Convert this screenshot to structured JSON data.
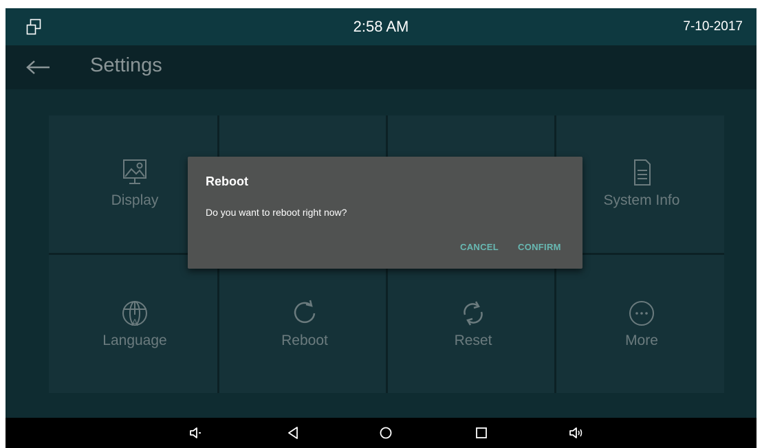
{
  "status_bar": {
    "window_icon": "window-restore-icon",
    "time": "2:58 AM",
    "date": "7-10-2017"
  },
  "app_bar": {
    "back_icon": "arrow-left-icon",
    "title": "Settings"
  },
  "tiles": [
    {
      "label": "Display",
      "icon": "display-image-icon"
    },
    {
      "label": "System Info",
      "icon": "document-icon"
    },
    {
      "label": "Language",
      "icon": "globe-language-icon"
    },
    {
      "label": "Reboot",
      "icon": "reboot-icon"
    },
    {
      "label": "Reset",
      "icon": "reset-icon"
    },
    {
      "label": "More",
      "icon": "more-dots-icon"
    }
  ],
  "dialog": {
    "title": "Reboot",
    "message": "Do you want to reboot right now?",
    "cancel_label": "CANCEL",
    "confirm_label": "CONFIRM"
  },
  "nav_bar": {
    "items": [
      "volume-down-icon",
      "back-triangle-icon",
      "home-circle-icon",
      "recents-square-icon",
      "volume-up-icon"
    ]
  },
  "colors": {
    "status_bar": "#0e3940",
    "app_bar": "#0c2328",
    "panel": "#153238",
    "dialog": "#505251",
    "accent": "#68b9b3"
  }
}
